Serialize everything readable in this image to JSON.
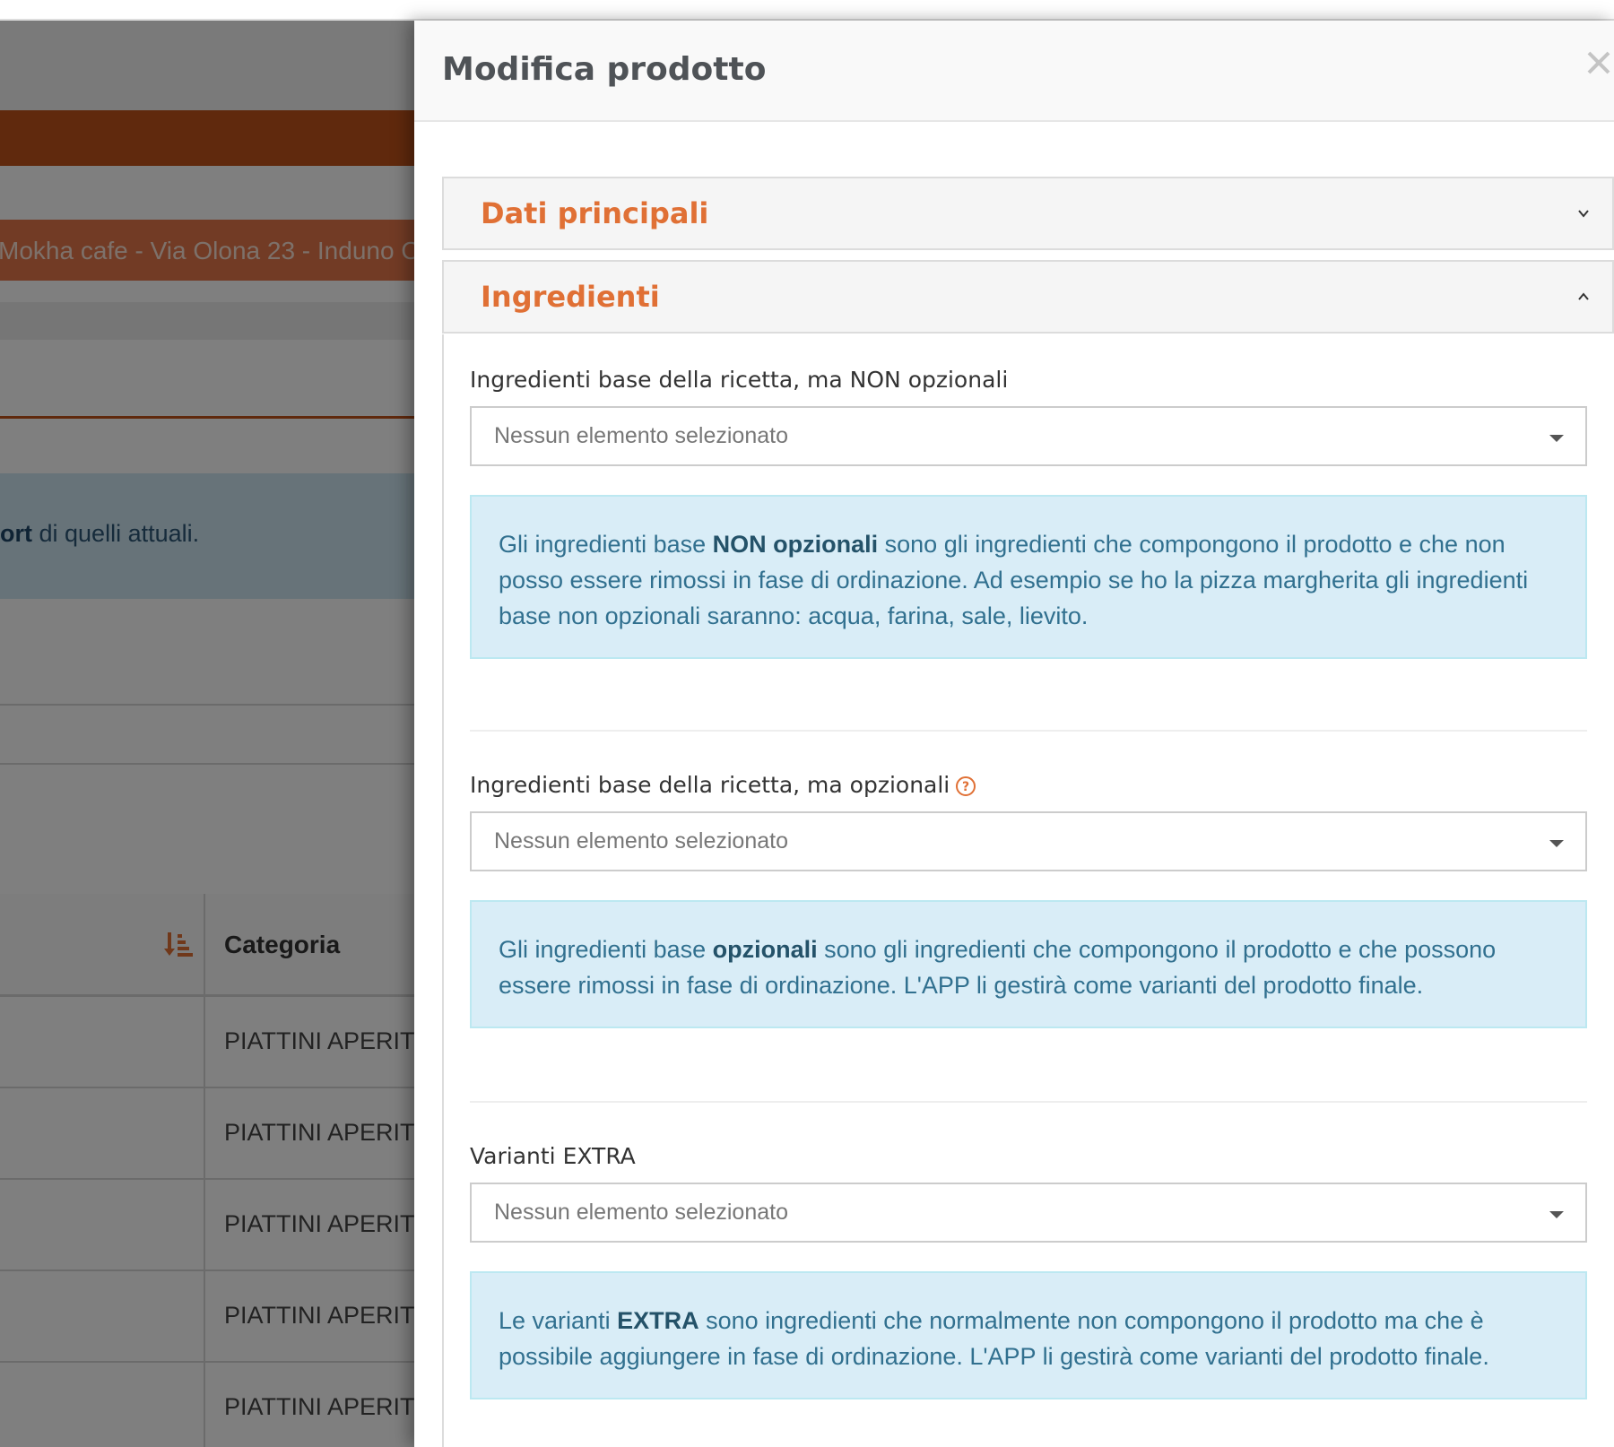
{
  "background": {
    "location_text": "Mokha cafe - Via Olona 23 - Induno O",
    "info_strong": "ort",
    "info_rest": " di quelli attuali.",
    "table": {
      "column_category": "Categoria",
      "rows": [
        "PIATTINI APERIT",
        "PIATTINI APERIT",
        "PIATTINI APERIT",
        "PIATTINI APERIT",
        "PIATTINI APERIT"
      ]
    }
  },
  "modal": {
    "title": "Modifica prodotto",
    "close_label": "×",
    "panels": {
      "main": {
        "title": "Dati principali"
      },
      "ingredients": {
        "title": "Ingredienti"
      }
    },
    "fields": {
      "base_non_optional": {
        "label": "Ingredienti base della ricetta, ma NON opzionali",
        "selected": "Nessun elemento selezionato",
        "info_pre": "Gli ingredienti base ",
        "info_strong": "NON opzionali",
        "info_post": " sono gli ingredienti che compongono il prodotto e che non posso essere rimossi in fase di ordinazione. Ad esempio se ho la pizza margherita gli ingredienti base non opzionali saranno: acqua, farina, sale, lievito."
      },
      "base_optional": {
        "label": "Ingredienti base della ricetta, ma opzionali",
        "selected": "Nessun elemento selezionato",
        "info_pre": "Gli ingredienti base ",
        "info_strong": "opzionali",
        "info_post": " sono gli ingredienti che compongono il prodotto e che possono essere rimossi in fase di ordinazione. L'APP li gestirà come varianti del prodotto finale."
      },
      "extra": {
        "label": "Varianti EXTRA",
        "selected": "Nessun elemento selezionato",
        "info_pre": "Le varianti ",
        "info_strong": "EXTRA",
        "info_post": " sono ingredienti che normalmente non compongono il prodotto ma che è possibile aggiungere in fase di ordinazione. L'APP li gestirà come varianti del prodotto finale."
      }
    }
  },
  "colors": {
    "accent_orange": "#e07035",
    "info_bg": "#d9edf7",
    "info_text": "#31708f",
    "overlay": "rgba(0,0,0,0.5)"
  }
}
